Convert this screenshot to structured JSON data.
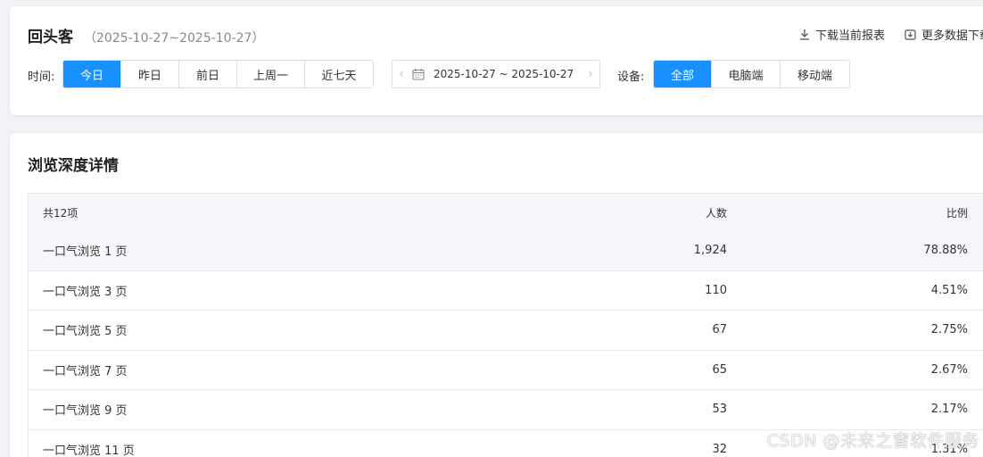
{
  "header": {
    "title": "回头客",
    "date_range": "（2025-10-27~2025-10-27）",
    "actions": {
      "download_current": "下载当前报表",
      "more_download": "更多数据下载"
    }
  },
  "filters": {
    "time_label": "时间:",
    "time_options": [
      "今日",
      "昨日",
      "前日",
      "上周一",
      "近七天"
    ],
    "time_selected": "今日",
    "date_picker_value": "2025-10-27 ~ 2025-10-27",
    "device_label": "设备:",
    "device_options": [
      "全部",
      "电脑端",
      "移动端"
    ],
    "device_selected": "全部"
  },
  "detail": {
    "title": "浏览深度详情",
    "columns": [
      "共12项",
      "人数",
      "比例"
    ],
    "rows": [
      {
        "name": "一口气浏览 1 页",
        "count": "1,924",
        "ratio": "78.88%"
      },
      {
        "name": "一口气浏览 3 页",
        "count": "110",
        "ratio": "4.51%"
      },
      {
        "name": "一口气浏览 5 页",
        "count": "67",
        "ratio": "2.75%"
      },
      {
        "name": "一口气浏览 7 页",
        "count": "65",
        "ratio": "2.67%"
      },
      {
        "name": "一口气浏览 9 页",
        "count": "53",
        "ratio": "2.17%"
      },
      {
        "name": "一口气浏览 11 页",
        "count": "32",
        "ratio": "1.31%"
      }
    ]
  },
  "watermark": "CSDN @未来之窗软件服务",
  "colors": {
    "accent": "#1890ff",
    "header_bg": "#f5f7fa",
    "border": "#dcdfe6"
  }
}
